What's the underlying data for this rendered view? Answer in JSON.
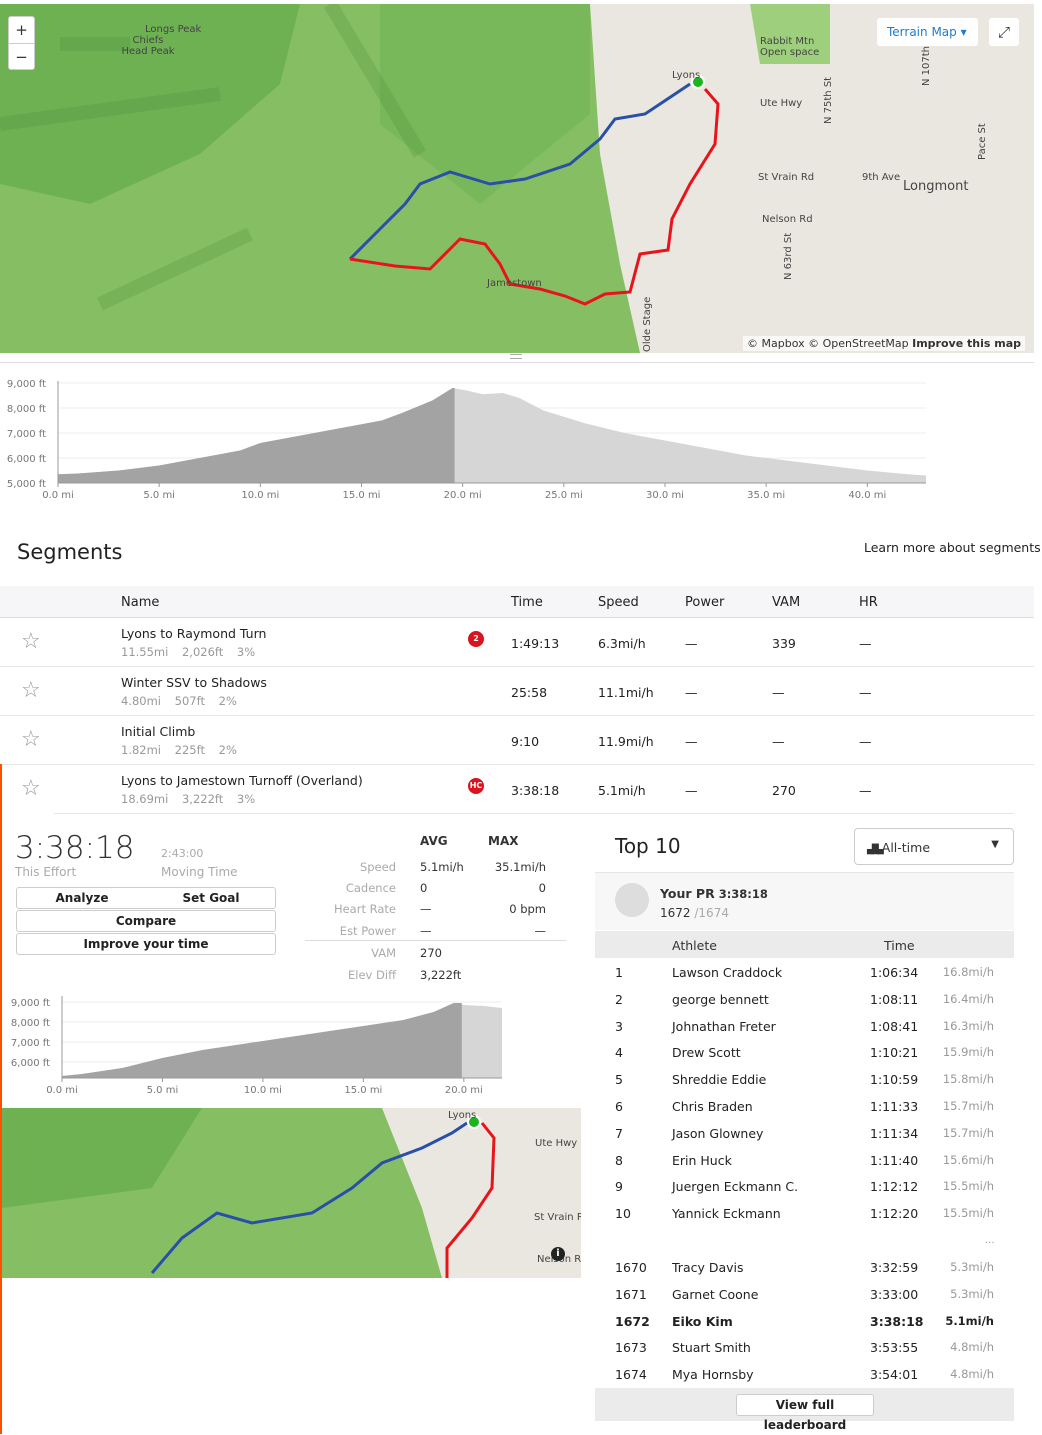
{
  "map": {
    "zoom_in": "+",
    "zoom_out": "−",
    "map_type": "Terrain Map",
    "fullscreen_icon": "expand-icon",
    "attribution": "© Mapbox © OpenStreetMap",
    "improve": "Improve this map",
    "labels": [
      "Longs Peak",
      "Chiefs Head Peak",
      "Rabbit Mtn Open space",
      "Lyons",
      "Ute Hwy",
      "St Vrain Rd",
      "9th Ave",
      "Longmont",
      "Nelson Rd",
      "Jamestown",
      "N 75th St",
      "N 63rd St",
      "N 107th",
      "Pace St",
      "Olde Stage"
    ],
    "route_colors": {
      "climb": "#e8141c",
      "descent": "#2a4fa8",
      "start": "#1db31d"
    }
  },
  "elevation_chart": {
    "type": "area",
    "y_ticks": [
      "9,000 ft",
      "8,000 ft",
      "7,000 ft",
      "6,000 ft",
      "5,000 ft"
    ],
    "x_ticks": [
      "0.0 mi",
      "5.0 mi",
      "10.0 mi",
      "15.0 mi",
      "20.0 mi",
      "25.0 mi",
      "30.0 mi",
      "35.0 mi",
      "40.0 mi"
    ],
    "xlim": [
      0,
      42.9
    ],
    "ylim": [
      5000,
      9000
    ],
    "profile": [
      [
        0,
        5350
      ],
      [
        1,
        5380
      ],
      [
        3,
        5500
      ],
      [
        5,
        5700
      ],
      [
        7,
        6000
      ],
      [
        9,
        6300
      ],
      [
        10,
        6600
      ],
      [
        12,
        6900
      ],
      [
        14,
        7200
      ],
      [
        16,
        7500
      ],
      [
        17,
        7800
      ],
      [
        18.5,
        8300
      ],
      [
        19.5,
        8800
      ],
      [
        20.2,
        8700
      ],
      [
        21,
        8550
      ],
      [
        22,
        8600
      ],
      [
        22.8,
        8400
      ],
      [
        24,
        7900
      ],
      [
        26,
        7400
      ],
      [
        28,
        7000
      ],
      [
        30,
        6700
      ],
      [
        32,
        6400
      ],
      [
        34,
        6100
      ],
      [
        36,
        5900
      ],
      [
        38,
        5700
      ],
      [
        40,
        5500
      ],
      [
        42,
        5350
      ],
      [
        42.9,
        5300
      ]
    ],
    "highlight_end": 19.6
  },
  "segments": {
    "title": "Segments",
    "learn_more": "Learn more about segments",
    "columns": [
      "Name",
      "Time",
      "Speed",
      "Power",
      "VAM",
      "HR"
    ],
    "rows": [
      {
        "name": "Lyons to Raymond Turn",
        "dist": "11.55mi",
        "elev": "2,026ft",
        "grade": "3%",
        "badge": "2",
        "time": "1:49:13",
        "speed": "6.3mi/h",
        "power": "—",
        "vam": "339",
        "hr": "—"
      },
      {
        "name": "Winter SSV to Shadows",
        "dist": "4.80mi",
        "elev": "507ft",
        "grade": "2%",
        "badge": "",
        "time": "25:58",
        "speed": "11.1mi/h",
        "power": "—",
        "vam": "—",
        "hr": "—"
      },
      {
        "name": "Initial Climb",
        "dist": "1.82mi",
        "elev": "225ft",
        "grade": "2%",
        "badge": "",
        "time": "9:10",
        "speed": "11.9mi/h",
        "power": "—",
        "vam": "—",
        "hr": "—"
      },
      {
        "name": "Lyons to Jamestown Turnoff (Overland)",
        "dist": "18.69mi",
        "elev": "3,222ft",
        "grade": "3%",
        "badge": "HC",
        "time": "3:38:18",
        "speed": "5.1mi/h",
        "power": "—",
        "vam": "270",
        "hr": "—"
      }
    ]
  },
  "detail": {
    "effort_time": "3:38:18",
    "effort_label": "This Effort",
    "moving_time": "2:43:00",
    "moving_label": "Moving Time",
    "buttons": {
      "analyze": "Analyze",
      "set_goal": "Set Goal",
      "compare": "Compare",
      "improve": "Improve your time"
    },
    "stats_head": {
      "avg": "AVG",
      "max": "MAX"
    },
    "stats": [
      {
        "label": "Speed",
        "avg": "5.1mi/h",
        "max": "35.1mi/h"
      },
      {
        "label": "Cadence",
        "avg": "0",
        "max": "0"
      },
      {
        "label": "Heart Rate",
        "avg": "—",
        "max": "0 bpm"
      },
      {
        "label": "Est Power",
        "avg": "—",
        "max": "—"
      },
      {
        "label": "VAM",
        "avg": "270",
        "max": ""
      },
      {
        "label": "Elev Diff",
        "avg": "3,222ft",
        "max": ""
      }
    ],
    "chart": {
      "type": "area",
      "y_ticks": [
        "9,000 ft",
        "8,000 ft",
        "7,000 ft",
        "6,000 ft"
      ],
      "x_ticks": [
        "0.0 mi",
        "5.0 mi",
        "10.0 mi",
        "15.0 mi",
        "20.0 mi"
      ],
      "xlim": [
        0,
        21.9
      ],
      "ylim": [
        5200,
        9200
      ],
      "profile": [
        [
          0,
          5300
        ],
        [
          1,
          5400
        ],
        [
          3,
          5700
        ],
        [
          5,
          6200
        ],
        [
          7,
          6600
        ],
        [
          9,
          6900
        ],
        [
          11,
          7200
        ],
        [
          13,
          7500
        ],
        [
          15,
          7800
        ],
        [
          17,
          8100
        ],
        [
          18.5,
          8500
        ],
        [
          19.5,
          8950
        ],
        [
          20,
          8850
        ],
        [
          21,
          8800
        ],
        [
          21.9,
          8700
        ]
      ],
      "highlight_end": 19.9
    },
    "map_labels": [
      "Lyons",
      "Ute Hwy",
      "St Vrain Rd",
      "Nelson Rd"
    ]
  },
  "leaderboard": {
    "title": "Top 10",
    "filter": "All-time",
    "pr_label": "Your PR",
    "pr_time": "3:38:18",
    "rank": "1672",
    "total": "/1674",
    "col_athlete": "Athlete",
    "col_time": "Time",
    "ellipsis": "...",
    "top": [
      [
        "1",
        "Lawson Craddock",
        "1:06:34",
        "16.8mi/h"
      ],
      [
        "2",
        "george bennett",
        "1:08:11",
        "16.4mi/h"
      ],
      [
        "3",
        "Johnathan Freter",
        "1:08:41",
        "16.3mi/h"
      ],
      [
        "4",
        "Drew Scott",
        "1:10:21",
        "15.9mi/h"
      ],
      [
        "5",
        "Shreddie Eddie",
        "1:10:59",
        "15.8mi/h"
      ],
      [
        "6",
        "Chris Braden",
        "1:11:33",
        "15.7mi/h"
      ],
      [
        "7",
        "Jason Glowney",
        "1:11:34",
        "15.7mi/h"
      ],
      [
        "8",
        "Erin Huck",
        "1:11:40",
        "15.6mi/h"
      ],
      [
        "9",
        "Juergen Eckmann C.",
        "1:12:12",
        "15.5mi/h"
      ],
      [
        "10",
        "Yannick Eckmann",
        "1:12:20",
        "15.5mi/h"
      ]
    ],
    "near": [
      [
        "1670",
        "Tracy Davis",
        "3:32:59",
        "5.3mi/h"
      ],
      [
        "1671",
        "Garnet Coone",
        "3:33:00",
        "5.3mi/h"
      ],
      [
        "1672",
        "Eiko Kim",
        "3:38:18",
        "5.1mi/h"
      ],
      [
        "1673",
        "Stuart Smith",
        "3:53:55",
        "4.8mi/h"
      ],
      [
        "1674",
        "Mya Hornsby",
        "3:54:01",
        "4.8mi/h"
      ]
    ],
    "view_full": "View full leaderboard"
  }
}
